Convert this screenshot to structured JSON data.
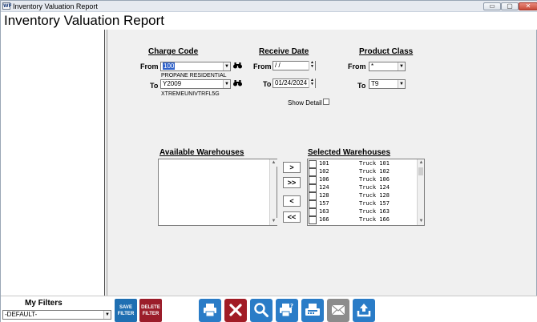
{
  "window": {
    "title": "Inventory Valuation Report",
    "minimize_glyph": "▭",
    "restore_glyph": "▢",
    "close_glyph": "✕",
    "app_icon_text": "WF"
  },
  "report": {
    "title": "Inventory Valuation Report"
  },
  "charge_code": {
    "heading": "Charge Code",
    "from_label": "From",
    "from_value": "100",
    "from_desc": "PROPANE RESIDENTIAL",
    "to_label": "To",
    "to_value": "Y2009",
    "to_desc": "XTREMEUNIVTRFL5G"
  },
  "receive_date": {
    "heading": "Receive Date",
    "from_label": "From",
    "from_value": " / /",
    "to_label": "To",
    "to_value": "01/24/2024"
  },
  "product_class": {
    "heading": "Product Class",
    "from_label": "From",
    "from_value": "*",
    "to_label": "To",
    "to_value": "T9"
  },
  "show_detail": {
    "label": "Show Detail",
    "checked": false
  },
  "available_warehouses": {
    "heading": "Available Warehouses",
    "items": []
  },
  "move_buttons": {
    "add_one": ">",
    "add_all": ">>",
    "remove_one": "<",
    "remove_all": "<<"
  },
  "selected_warehouses": {
    "heading": "Selected Warehouses",
    "rows": [
      {
        "code": "101",
        "name": "Truck 101"
      },
      {
        "code": "102",
        "name": "Truck 102"
      },
      {
        "code": "106",
        "name": "Truck 106"
      },
      {
        "code": "124",
        "name": "Truck 124"
      },
      {
        "code": "128",
        "name": "Truck 128"
      },
      {
        "code": "157",
        "name": "Truck 157"
      },
      {
        "code": "163",
        "name": "Truck 163"
      },
      {
        "code": "166",
        "name": "Truck 166"
      }
    ]
  },
  "my_filters": {
    "label": "My Filters",
    "selected": "-DEFAULT-"
  },
  "toolbar": {
    "save_filter_line1": "SAVE",
    "save_filter_line2": "FILTER",
    "delete_filter_line1": "DELETE",
    "delete_filter_line2": "FILTER",
    "icons": [
      "print-icon",
      "close-icon",
      "search-icon",
      "print-preview-icon",
      "fax-icon",
      "email-icon",
      "export-icon"
    ]
  },
  "colors": {
    "save_filter_bg": "#1f6fb2",
    "delete_filter_bg": "#9b1d2a",
    "print_bg": "#2a7cc7",
    "cancel_bg": "#a11c25",
    "search_bg": "#2a7cc7",
    "preview_bg": "#2a7cc7",
    "fax_bg": "#2a7cc7",
    "email_bg": "#8c8c8c",
    "export_bg": "#2a7cc7"
  }
}
